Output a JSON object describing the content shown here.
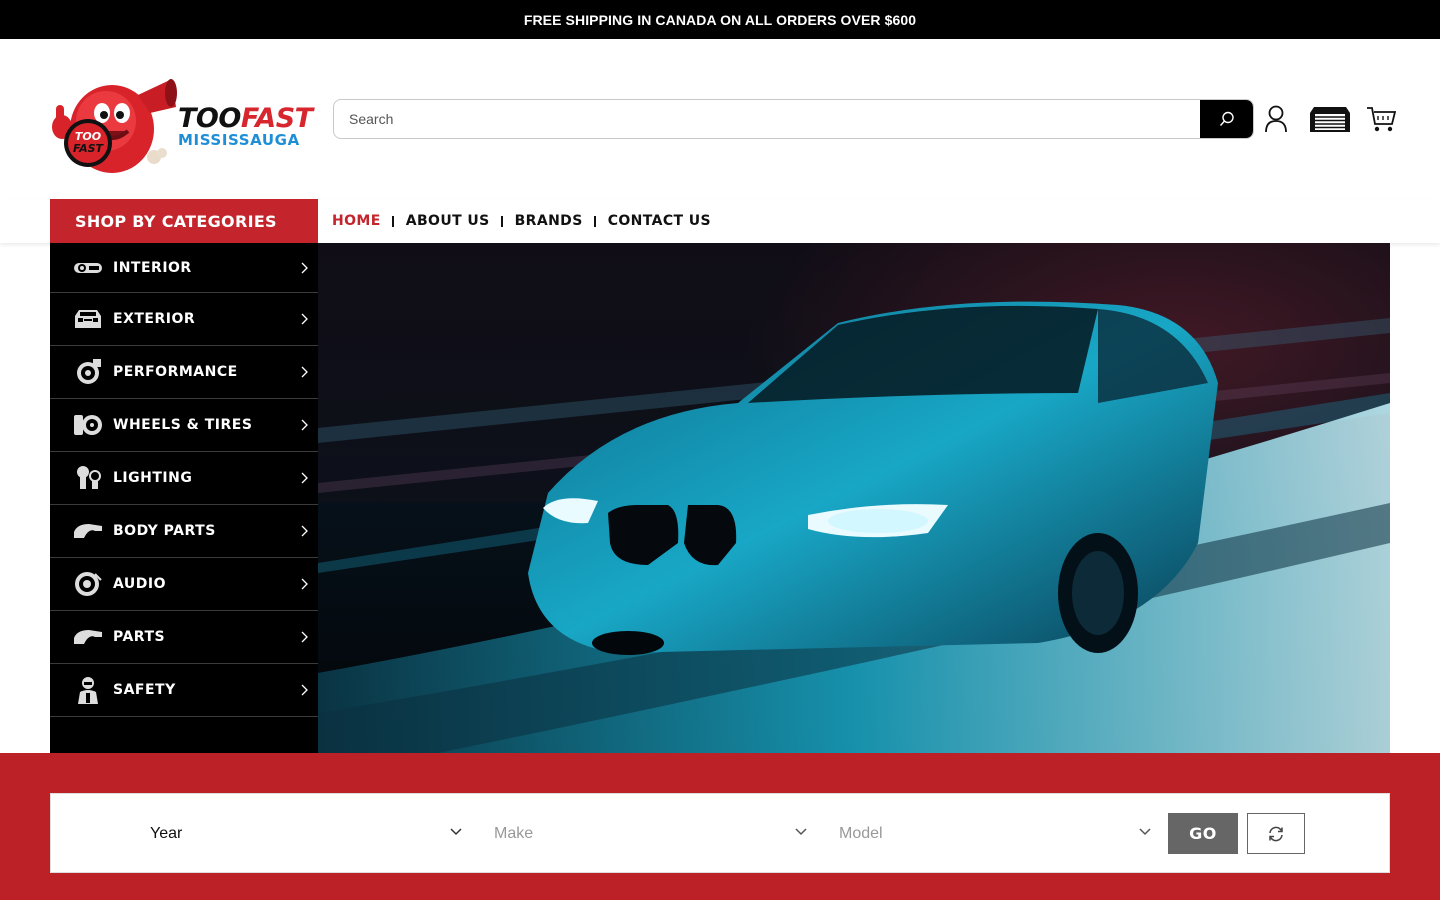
{
  "announcement": "FREE SHIPPING IN CANADA ON ALL ORDERS OVER $600",
  "brand": {
    "name_part1": "TOO",
    "name_part2": "FAST",
    "name_line2": "MISSISSAUGA",
    "mascot_badge": "TOO FAST",
    "colors": {
      "red": "#d7262e",
      "blue": "#1e8fd6",
      "black": "#111111"
    }
  },
  "search": {
    "placeholder": "Search",
    "value": "",
    "button_icon": "search-icon"
  },
  "header_icons": [
    "account-icon",
    "garage-icon",
    "cart-icon"
  ],
  "categories": {
    "title": "SHOP BY CATEGORIES",
    "items": [
      {
        "label": "INTERIOR",
        "icon": "steering-wheel-icon"
      },
      {
        "label": "EXTERIOR",
        "icon": "car-front-icon"
      },
      {
        "label": "PERFORMANCE",
        "icon": "turbo-icon"
      },
      {
        "label": "WHEELS & TIRES",
        "icon": "wheel-icon"
      },
      {
        "label": "LIGHTING",
        "icon": "bulb-icon"
      },
      {
        "label": "BODY PARTS",
        "icon": "fender-icon"
      },
      {
        "label": "AUDIO",
        "icon": "speaker-icon"
      },
      {
        "label": "PARTS",
        "icon": "fender-icon"
      },
      {
        "label": "SAFETY",
        "icon": "driver-icon"
      }
    ]
  },
  "nav": {
    "items": [
      {
        "label": "HOME",
        "active": true
      },
      {
        "label": "ABOUT US",
        "active": false
      },
      {
        "label": "BRANDS",
        "active": false
      },
      {
        "label": "CONTACT US",
        "active": false
      }
    ]
  },
  "hero": {
    "image": "blue sedan driving at speed",
    "accent": "#19b4d6"
  },
  "vehicle_finder": {
    "year_label": "Year",
    "make_label": "Make",
    "model_label": "Model",
    "go_label": "GO",
    "reset_icon": "refresh-icon",
    "band_color": "#bd2128"
  }
}
